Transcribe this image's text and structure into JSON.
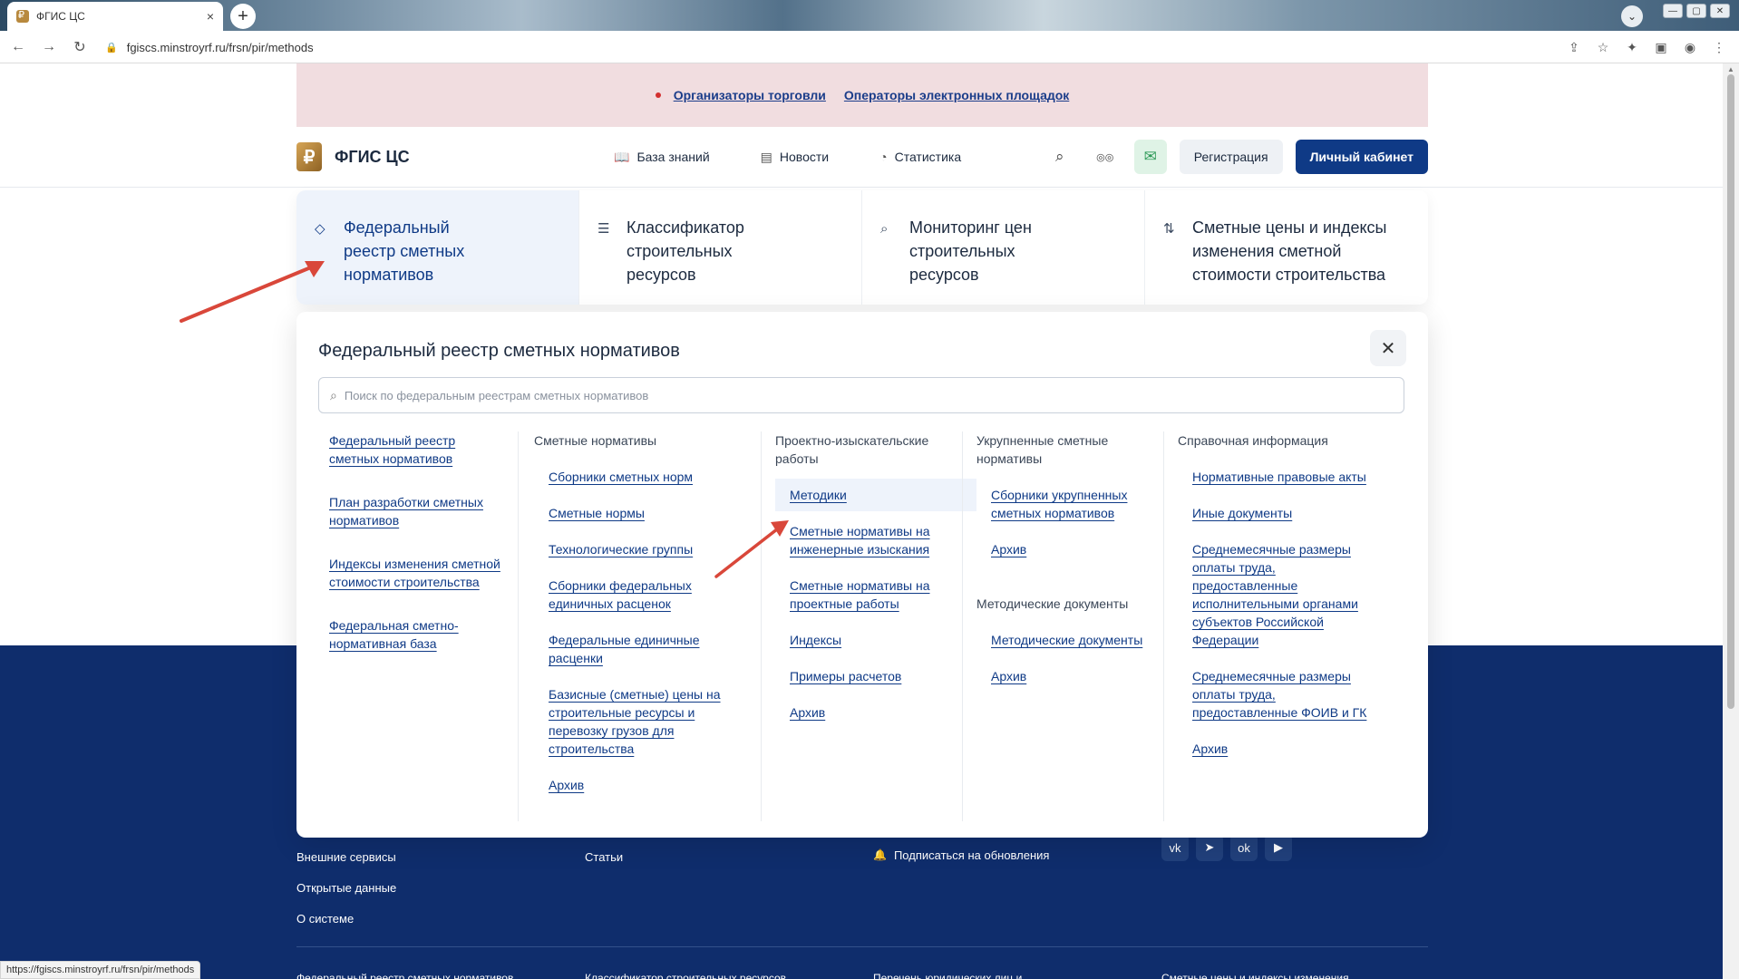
{
  "browser": {
    "tab_title": "ФГИС ЦС",
    "tab_close": "×",
    "new_tab": "+",
    "url": "fgiscs.minstroyrf.ru/frsn/pir/methods",
    "status_url": "https://fgiscs.minstroyrf.ru/frsn/pir/methods",
    "nav_back": "←",
    "nav_forward": "→",
    "nav_reload": "↻",
    "lock": "🔒",
    "tab_dropdown": "⌄",
    "win_min": "—",
    "win_max": "▢",
    "win_close": "✕",
    "right_icons": [
      "⇪",
      "☆",
      "✦",
      "▣",
      "◉",
      "⋮"
    ]
  },
  "banner": {
    "links": [
      "Организаторы торговли",
      "Операторы электронных площадок"
    ]
  },
  "header": {
    "logo_glyph": "₽",
    "logo_text": "ФГИС ЦС",
    "nav": [
      {
        "icon": "book-icon",
        "glyph": "📖",
        "label": "База знаний"
      },
      {
        "icon": "news-icon",
        "glyph": "▤",
        "label": "Новости"
      },
      {
        "icon": "chart-icon",
        "glyph": "◔",
        "label": "Статистика"
      }
    ],
    "search_glyph": "⌕",
    "glasses_glyph": "◎◎",
    "mail_glyph": "✉",
    "register_label": "Регистрация",
    "cabinet_label": "Личный кабинет"
  },
  "main_nav": [
    {
      "icon": "tag-icon",
      "glyph": "◇",
      "label": "Федеральный реестр сметных нормативов",
      "active": true
    },
    {
      "icon": "list-icon",
      "glyph": "☰",
      "label": "Классификатор строительных ресурсов",
      "active": false
    },
    {
      "icon": "search-icon",
      "glyph": "⌕",
      "label": "Мониторинг цен строительных ресурсов",
      "active": false
    },
    {
      "icon": "sort-icon",
      "glyph": "⇅",
      "label": "Сметные цены и индексы изменения сметной стоимости строительства",
      "active": false
    }
  ],
  "panel": {
    "title": "Федеральный реестр сметных нормативов",
    "close_glyph": "✕",
    "search_placeholder": "Поиск по федеральным реестрам сметных нормативов",
    "search_glyph": "⌕",
    "col1": {
      "links": [
        "Федеральный реестр сметных нормативов",
        "План разработки сметных нормативов",
        "Индексы изменения сметной стоимости строительства",
        "Федеральная сметно-нормативная база"
      ]
    },
    "col2": {
      "head": "Сметные нормативы",
      "links": [
        "Сборники сметных норм",
        "Сметные нормы",
        "Технологические группы",
        "Сборники федеральных единичных расценок",
        "Федеральные единичные расценки",
        "Базисные (сметные) цены на строительные ресурсы и перевозку грузов для строительства",
        "Архив"
      ]
    },
    "col3": {
      "head": "Проектно-изыскательские работы",
      "links": [
        "Методики",
        "Сметные нормативы на инженерные изыскания",
        "Сметные нормативы на проектные работы",
        "Индексы",
        "Примеры расчетов",
        "Архив"
      ]
    },
    "col4": {
      "head": "Укрупненные сметные нормативы",
      "links": [
        "Сборники укрупненных сметных нормативов",
        "Архив"
      ],
      "head2": "Методические документы",
      "links2": [
        "Методические документы",
        "Архив"
      ]
    },
    "col5": {
      "head": "Справочная информация",
      "links": [
        "Нормативные правовые акты",
        "Иные документы",
        "Среднемесячные размеры оплаты труда, предоставленные исполнительными органами субъектов Российской Федерации",
        "Среднемесячные размеры оплаты труда, предоставленные ФОИВ и ГК",
        "Архив"
      ]
    }
  },
  "footer": {
    "col1": [
      "Внешние сервисы",
      "Открытые данные",
      "О системе"
    ],
    "col2": [
      "Статьи"
    ],
    "subscribe": "Подписаться на обновления",
    "bell_glyph": "🔔",
    "social": [
      {
        "icon": "vk-icon",
        "glyph": "vk"
      },
      {
        "icon": "telegram-icon",
        "glyph": "➤"
      },
      {
        "icon": "ok-icon",
        "glyph": "ok"
      },
      {
        "icon": "rutube-icon",
        "glyph": "▶"
      }
    ],
    "bottom": [
      "Федеральный реестр сметных нормативов",
      "Классификатор строительных ресурсов",
      "Перечень юридических лиц и",
      "Сметные цены и индексы изменения"
    ]
  },
  "colors": {
    "brand_blue": "#0f3a86",
    "footer_bg": "#0f2d6c",
    "banner_bg": "#f1dde0",
    "annotation_arrow": "#d9473a"
  }
}
